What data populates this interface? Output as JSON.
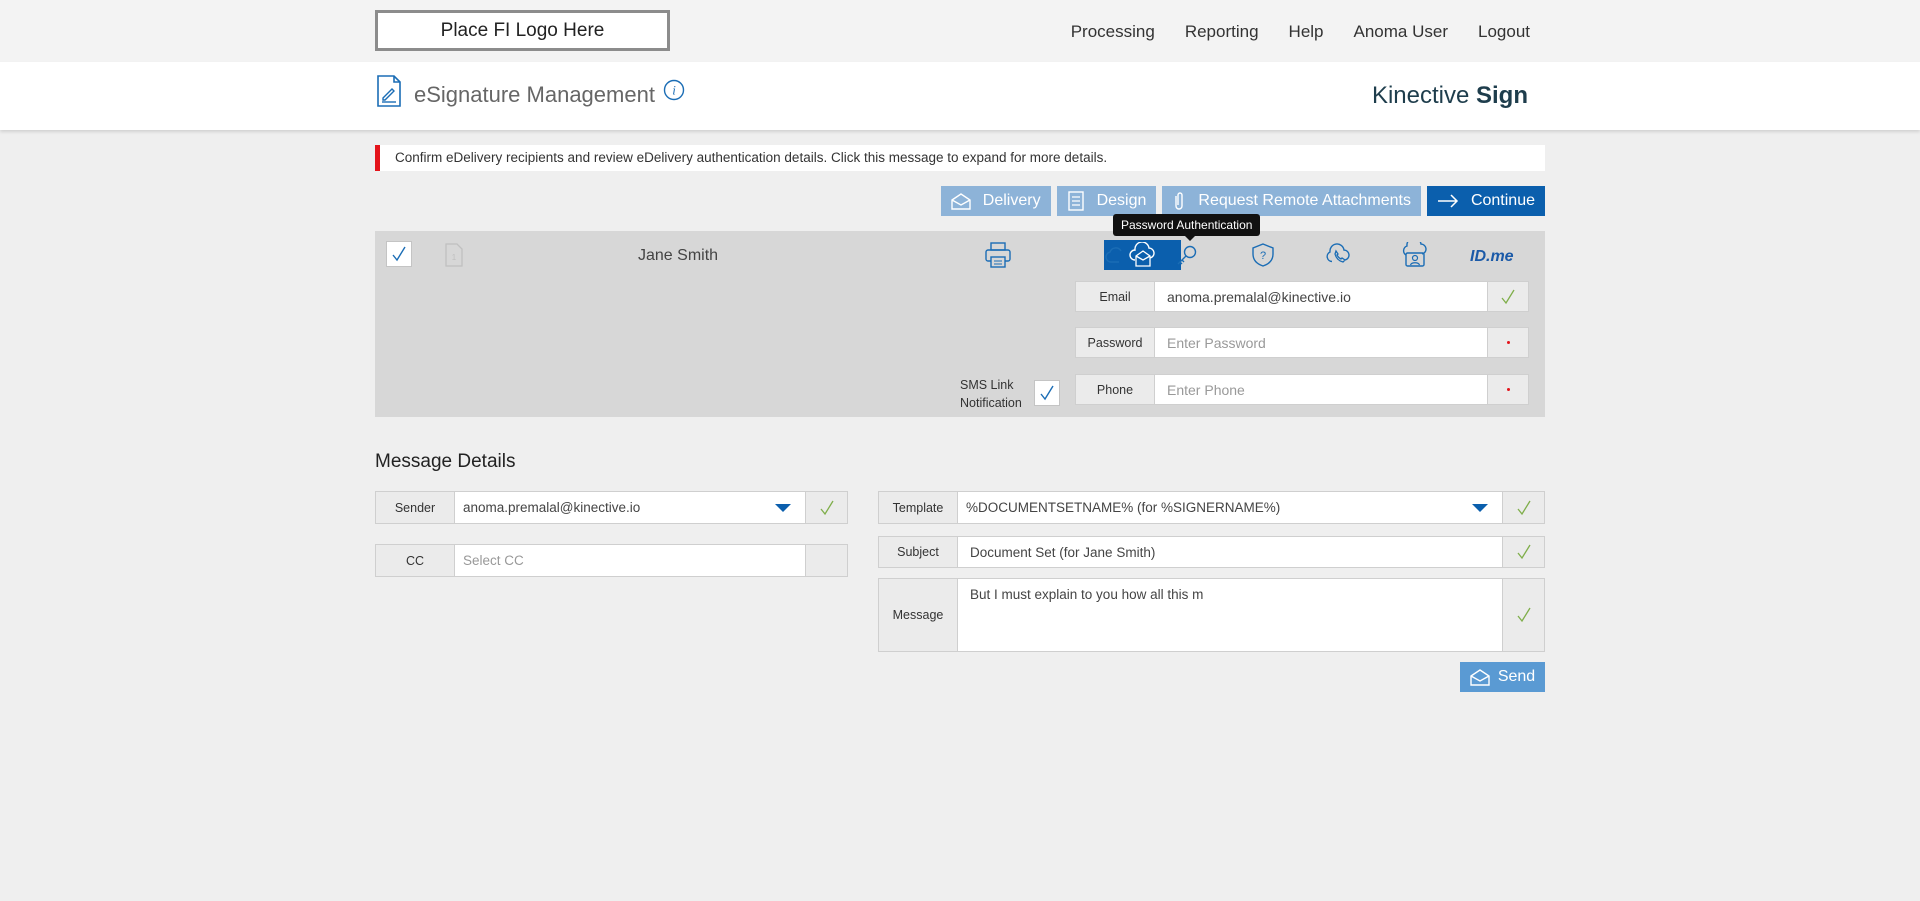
{
  "topbar": {
    "logo_text": "Place FI Logo Here",
    "nav": [
      "Processing",
      "Reporting",
      "Help",
      "Anoma User",
      "Logout"
    ]
  },
  "header": {
    "title": "eSignature Management",
    "brand_light": "Kinective",
    "brand_bold": "Sign"
  },
  "alert": {
    "text": "Confirm eDelivery recipients and review eDelivery authentication details. Click this message to expand for more details."
  },
  "actions": {
    "delivery": "Delivery",
    "design": "Design",
    "remote_attachments": "Request Remote Attachments",
    "continue": "Continue"
  },
  "recipient": {
    "name": "Jane Smith",
    "tooltip": "Password Authentication",
    "idme_label": "ID.me",
    "email_label": "Email",
    "email_value": "anoma.premalal@kinective.io",
    "password_label": "Password",
    "password_placeholder": "Enter Password",
    "phone_label": "Phone",
    "phone_placeholder": "Enter Phone",
    "sms_label_1": "SMS Link",
    "sms_label_2": "Notification"
  },
  "message": {
    "section_title": "Message Details",
    "sender_label": "Sender",
    "sender_value": "anoma.premalal@kinective.io",
    "cc_label": "CC",
    "cc_placeholder": "Select CC",
    "template_label": "Template",
    "template_value": "%DOCUMENTSETNAME% (for %SIGNERNAME%)",
    "subject_label": "Subject",
    "subject_value": "Document Set (for Jane Smith)",
    "message_label": "Message",
    "message_value": "But I must explain to you how all this m",
    "send_label": "Send"
  },
  "colors": {
    "primary": "#0b5fad",
    "light_button": "#8db3d8",
    "alert_red": "#e4141b",
    "check_green": "#7fae4a"
  }
}
